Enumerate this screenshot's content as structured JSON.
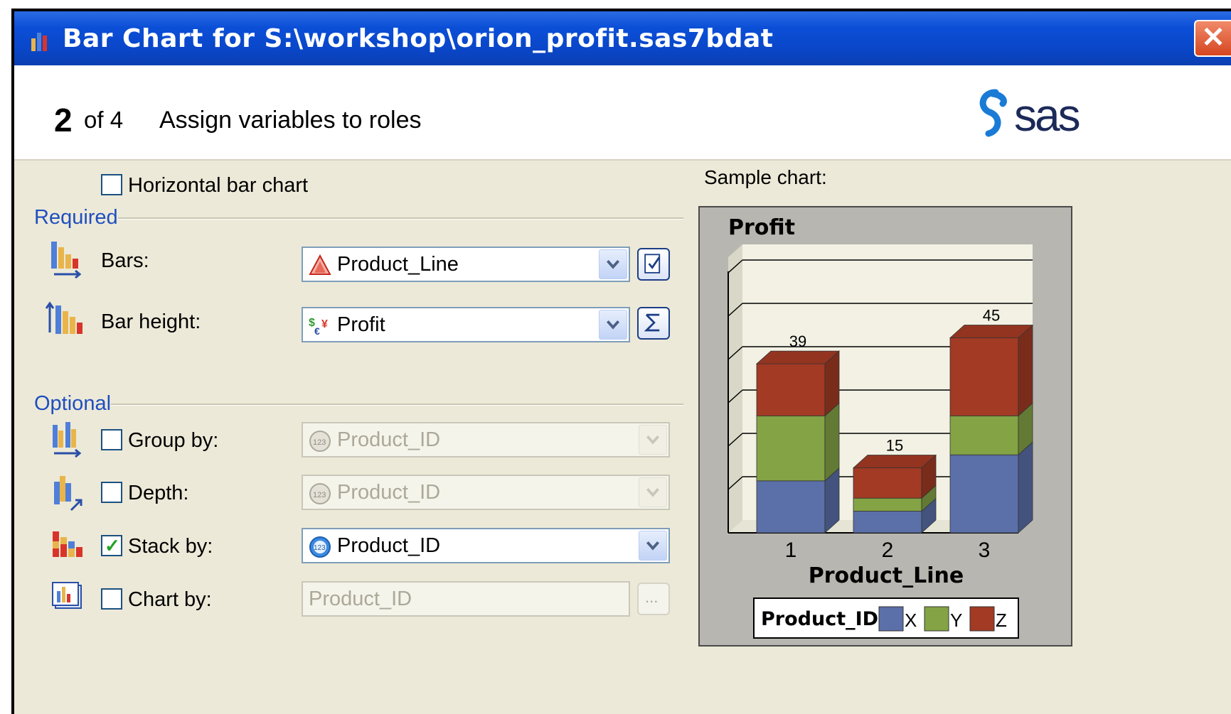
{
  "window": {
    "title": "Bar Chart for S:\\workshop\\orion_profit.sas7bdat",
    "close_label": "✕"
  },
  "header": {
    "step_number": "2",
    "step_of": "of 4",
    "step_title": "Assign variables to roles",
    "logo_text": "sas"
  },
  "options": {
    "horizontal_label": "Horizontal bar chart",
    "horizontal_checked": false
  },
  "required": {
    "section_label": "Required",
    "bars": {
      "label": "Bars:",
      "value": "Product_Line",
      "icon": "category-icon"
    },
    "bar_height": {
      "label": "Bar height:",
      "value": "Profit",
      "icon": "currency-icon"
    }
  },
  "optional": {
    "section_label": "Optional",
    "group_by": {
      "label": "Group by:",
      "value": "Product_ID",
      "checked": false
    },
    "depth": {
      "label": "Depth:",
      "value": "Product_ID",
      "checked": false
    },
    "stack_by": {
      "label": "Stack by:",
      "value": "Product_ID",
      "checked": true
    },
    "chart_by": {
      "label": "Chart by:",
      "value": "Product_ID",
      "checked": false,
      "browse_label": "..."
    }
  },
  "sample": {
    "label": "Sample chart:"
  },
  "colors": {
    "title_bar": "#0b4fd7",
    "section_text": "#1f4fbf",
    "series_x": "#5b6fa8",
    "series_y": "#84a345",
    "series_z": "#a23a24"
  },
  "chart_data": {
    "type": "bar",
    "title": "Profit",
    "xlabel": "Product_Line",
    "ylabel": "",
    "categories": [
      "1",
      "2",
      "3"
    ],
    "stacked": true,
    "series": [
      {
        "name": "X",
        "values": [
          12,
          5,
          18
        ]
      },
      {
        "name": "Y",
        "values": [
          15,
          3,
          9
        ]
      },
      {
        "name": "Z",
        "values": [
          12,
          7,
          18
        ]
      }
    ],
    "totals": [
      39,
      15,
      45
    ],
    "legend_title": "Product_ID",
    "legend_position": "bottom",
    "ylim": [
      0,
      60
    ],
    "grid": true
  }
}
